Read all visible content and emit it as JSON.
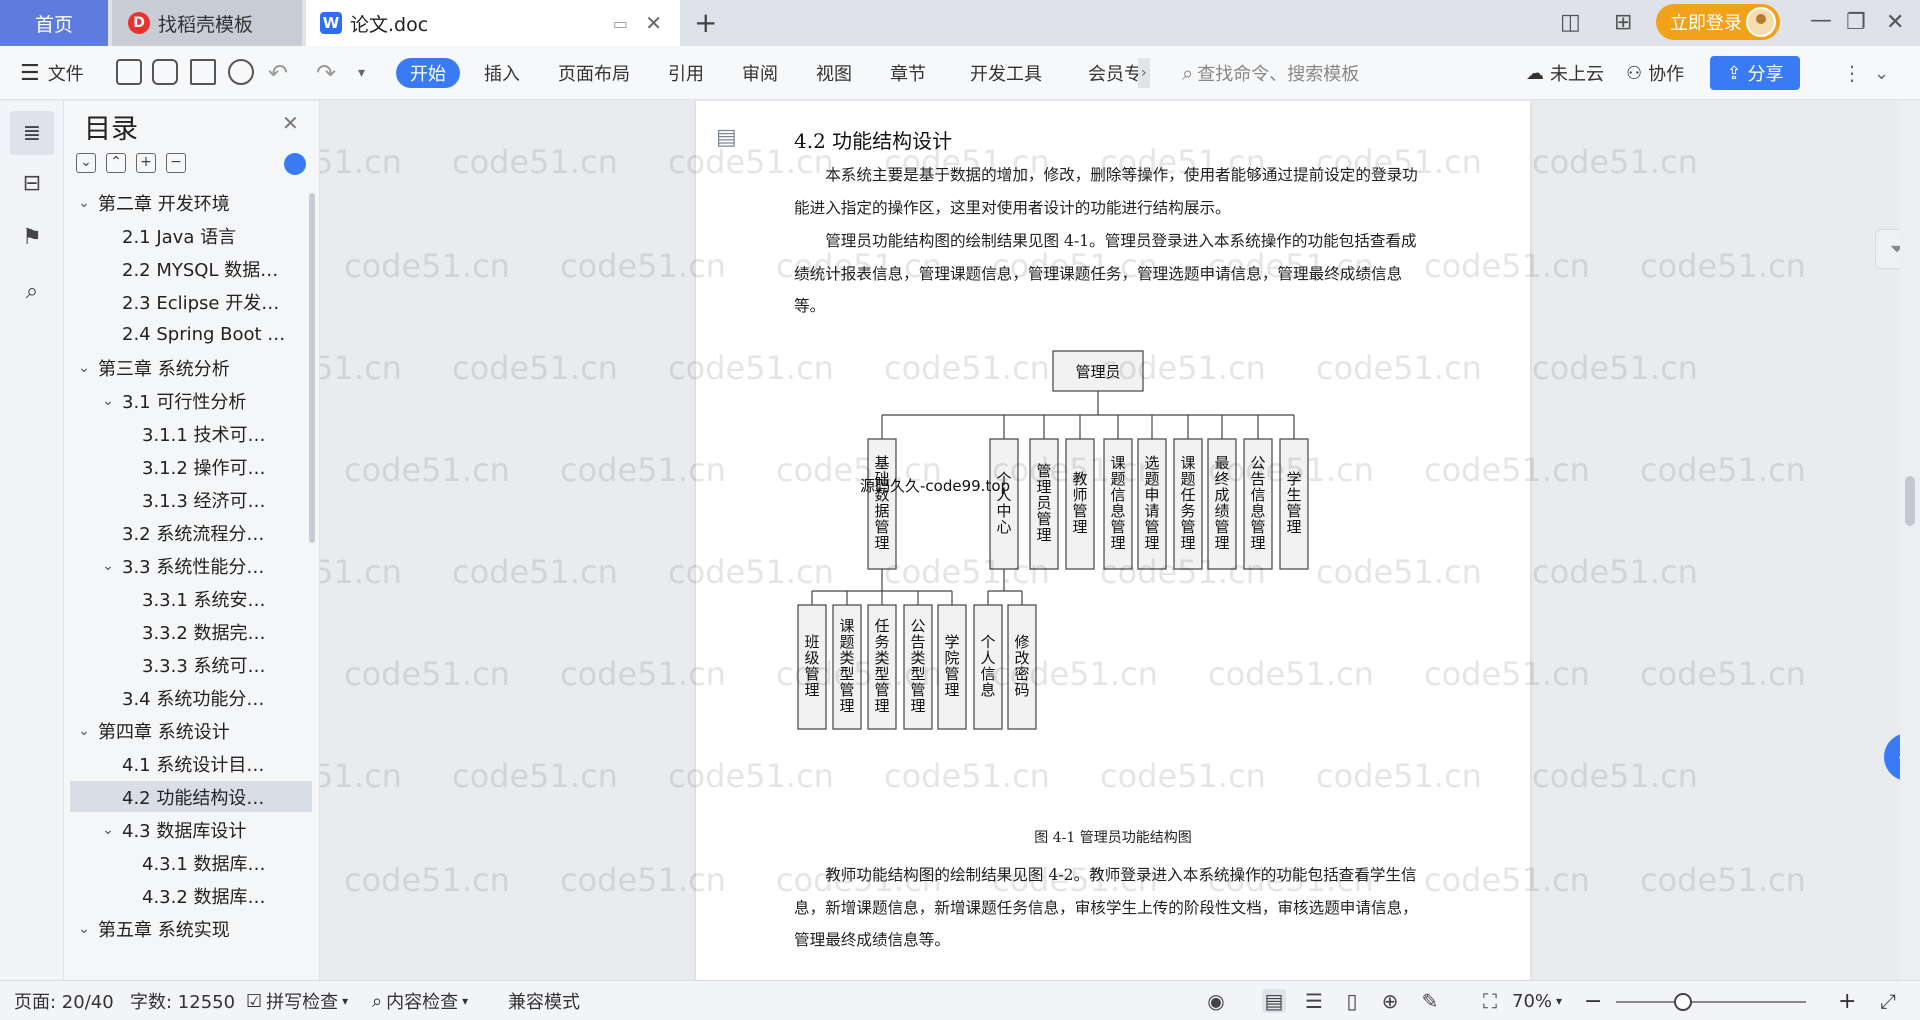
{
  "tabs": {
    "home": "首页",
    "template": "找稻壳模板",
    "document": "论文.doc"
  },
  "titlebar": {
    "login": "立即登录"
  },
  "toolbar": {
    "file": "文件",
    "tabs": [
      "开始",
      "插入",
      "页面布局",
      "引用",
      "审阅",
      "视图",
      "章节",
      "开发工具",
      "会员专"
    ],
    "search_placeholder": "查找命令、搜索模板",
    "cloud": "未上云",
    "collab": "协作",
    "share": "分享"
  },
  "toc": {
    "title": "目录",
    "items": [
      {
        "label": "第二章  开发环境",
        "level": 0,
        "caret": "v"
      },
      {
        "label": "2.1 Java 语言",
        "level": 1,
        "caret": ""
      },
      {
        "label": "2.2 MYSQL 数据…",
        "level": 1,
        "caret": ""
      },
      {
        "label": "2.3 Eclipse 开发…",
        "level": 1,
        "caret": ""
      },
      {
        "label": "2.4 Spring Boot …",
        "level": 1,
        "caret": ""
      },
      {
        "label": "第三章  系统分析",
        "level": 0,
        "caret": "v"
      },
      {
        "label": "3.1 可行性分析",
        "level": 1,
        "caret": "v"
      },
      {
        "label": "3.1.1 技术可…",
        "level": 2,
        "caret": ""
      },
      {
        "label": "3.1.2 操作可…",
        "level": 2,
        "caret": ""
      },
      {
        "label": "3.1.3 经济可…",
        "level": 2,
        "caret": ""
      },
      {
        "label": "3.2 系统流程分…",
        "level": 1,
        "caret": ""
      },
      {
        "label": "3.3 系统性能分…",
        "level": 1,
        "caret": "v"
      },
      {
        "label": "3.3.1 系统安…",
        "level": 2,
        "caret": ""
      },
      {
        "label": "3.3.2 数据完…",
        "level": 2,
        "caret": ""
      },
      {
        "label": "3.3.3 系统可…",
        "level": 2,
        "caret": ""
      },
      {
        "label": "3.4 系统功能分…",
        "level": 1,
        "caret": ""
      },
      {
        "label": "第四章  系统设计",
        "level": 0,
        "caret": "v"
      },
      {
        "label": "4.1  系统设计目…",
        "level": 1,
        "caret": ""
      },
      {
        "label": "4.2 功能结构设…",
        "level": 1,
        "caret": "",
        "selected": true
      },
      {
        "label": "4.3 数据库设计",
        "level": 1,
        "caret": "v"
      },
      {
        "label": "4.3.1  数据库…",
        "level": 2,
        "caret": ""
      },
      {
        "label": "4.3.2  数据库…",
        "level": 2,
        "caret": ""
      },
      {
        "label": "第五章  系统实现",
        "level": 0,
        "caret": "v"
      }
    ]
  },
  "document": {
    "heading": "4.2 功能结构设计",
    "para1": "本系统主要是基于数据的增加，修改，删除等操作，使用者能够通过提前设定的登录功能进入指定的操作区，这里对使用者设计的功能进行结构展示。",
    "para2": "管理员功能结构图的绘制结果见图 4-1。管理员登录进入本系统操作的功能包括查看成绩统计报表信息，管理课题信息，管理课题任务，管理选题申请信息，管理最终成绩信息等。",
    "caption": "图 4-1  管理员功能结构图",
    "para3": "教师功能结构图的绘制结果见图 4-2。教师登录进入本系统操作的功能包括查看学生信息，新增课题信息，新增课题任务信息，审核学生上传的阶段性文档，审核选题申请信息，管理最终成绩信息等。",
    "overlay_text": "源码久久-code99.top"
  },
  "diagram": {
    "root": "管理员",
    "level1": [
      "基础数据管理",
      "个人中心",
      "管理员管理",
      "教师管理",
      "课题信息管理",
      "选题申请管理",
      "课题任务管理",
      "最终成绩管理",
      "公告信息管理",
      "学生管理"
    ],
    "sub_basic": [
      "班级管理",
      "课题类型管理",
      "任务类型管理",
      "公告类型管理",
      "学院管理"
    ],
    "sub_personal": [
      "个人信息",
      "修改密码"
    ]
  },
  "watermark": "code51.cn",
  "statusbar": {
    "page": "页面: 20/40",
    "words": "字数: 12550",
    "spell": "拼写检查",
    "content_check": "内容检查",
    "compat": "兼容模式",
    "zoom": "70%"
  },
  "colors": {
    "accent": "#3a7bf5",
    "home_tab": "#5e7ce0",
    "login": "#f0a21b"
  }
}
